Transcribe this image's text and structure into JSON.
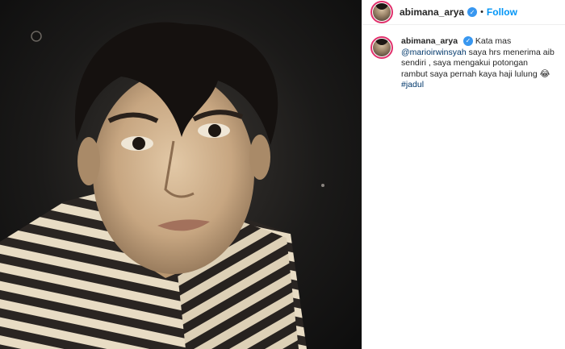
{
  "post": {
    "username": "abimana_arya",
    "separator": "•",
    "follow_label": "Follow",
    "verified_glyph": "✓"
  },
  "caption": {
    "username": "abimana_arya",
    "text_before": "Kata mas",
    "mention": "@marioirwinsyah",
    "text_after": "saya hrs menerima aib sendiri , saya mengakui potongan rambut saya pernah kaya haji lulung",
    "emoji": "😂",
    "hashtag": "#jadul"
  },
  "colors": {
    "verified": "#3897f0",
    "follow": "#0095f6",
    "link": "#00376b",
    "story_ring": "#e1306c"
  },
  "icons": [
    "verified-badge-icon"
  ]
}
